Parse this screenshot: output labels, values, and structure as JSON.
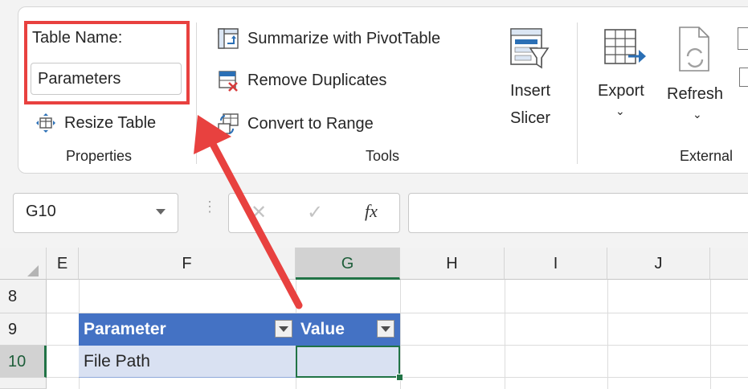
{
  "ribbon": {
    "properties": {
      "table_name_label": "Table Name:",
      "table_name_value": "Parameters",
      "resize_label": "Resize Table",
      "group_label": "Properties"
    },
    "tools": {
      "pivot_label": "Summarize with PivotTable",
      "dupes_label": "Remove Duplicates",
      "convert_label": "Convert to Range",
      "slicer_line1": "Insert",
      "slicer_line2": "Slicer",
      "group_label": "Tools"
    },
    "external": {
      "export_label": "Export",
      "refresh_label": "Refresh",
      "group_label": "External"
    }
  },
  "formula_bar": {
    "name_box": "G10",
    "fx_label": "fx",
    "formula_value": ""
  },
  "grid": {
    "columns": [
      "E",
      "F",
      "G",
      "H",
      "I",
      "J"
    ],
    "rows": [
      "8",
      "9",
      "10"
    ],
    "table": {
      "headers": [
        "Parameter",
        "Value"
      ],
      "rows": [
        [
          "File Path",
          ""
        ]
      ]
    }
  },
  "colors": {
    "highlight": "#e8413f",
    "table_header": "#4472c4",
    "table_row": "#d9e1f2",
    "selection": "#217346"
  }
}
